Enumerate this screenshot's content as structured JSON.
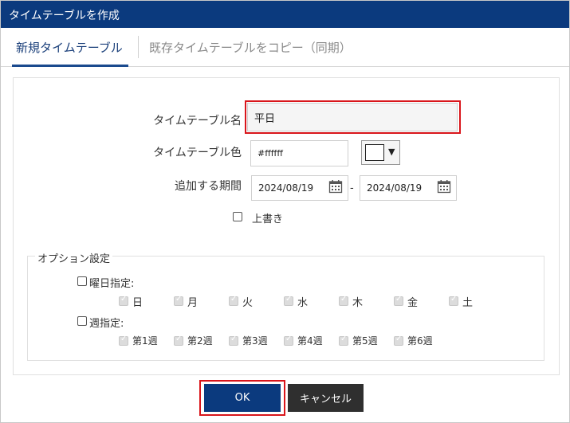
{
  "dialog": {
    "title": "タイムテーブルを作成"
  },
  "tabs": [
    {
      "label": "新規タイムテーブル",
      "active": true
    },
    {
      "label": "既存タイムテーブルをコピー（同期）",
      "active": false
    }
  ],
  "form": {
    "name": {
      "label": "タイムテーブル名",
      "value": "平日"
    },
    "color": {
      "label": "タイムテーブル色",
      "value": "#ffffff",
      "swatch": "#ffffff"
    },
    "period": {
      "label": "追加する期間",
      "start": "2024/08/19",
      "end": "2024/08/19",
      "separator": "-"
    },
    "overwrite": {
      "label": "上書き",
      "checked": false
    }
  },
  "options": {
    "legend": "オプション設定",
    "weekday": {
      "label": "曜日指定:",
      "checked": false,
      "days": [
        "日",
        "月",
        "火",
        "水",
        "木",
        "金",
        "土"
      ]
    },
    "week": {
      "label": "週指定:",
      "checked": false,
      "weeks": [
        "第1週",
        "第2週",
        "第3週",
        "第4週",
        "第5週",
        "第6週"
      ]
    }
  },
  "buttons": {
    "ok": "OK",
    "cancel": "キャンセル"
  },
  "colors": {
    "header": "#0b3a7e",
    "highlight": "#d9151b",
    "cancel": "#2f2f2f"
  }
}
